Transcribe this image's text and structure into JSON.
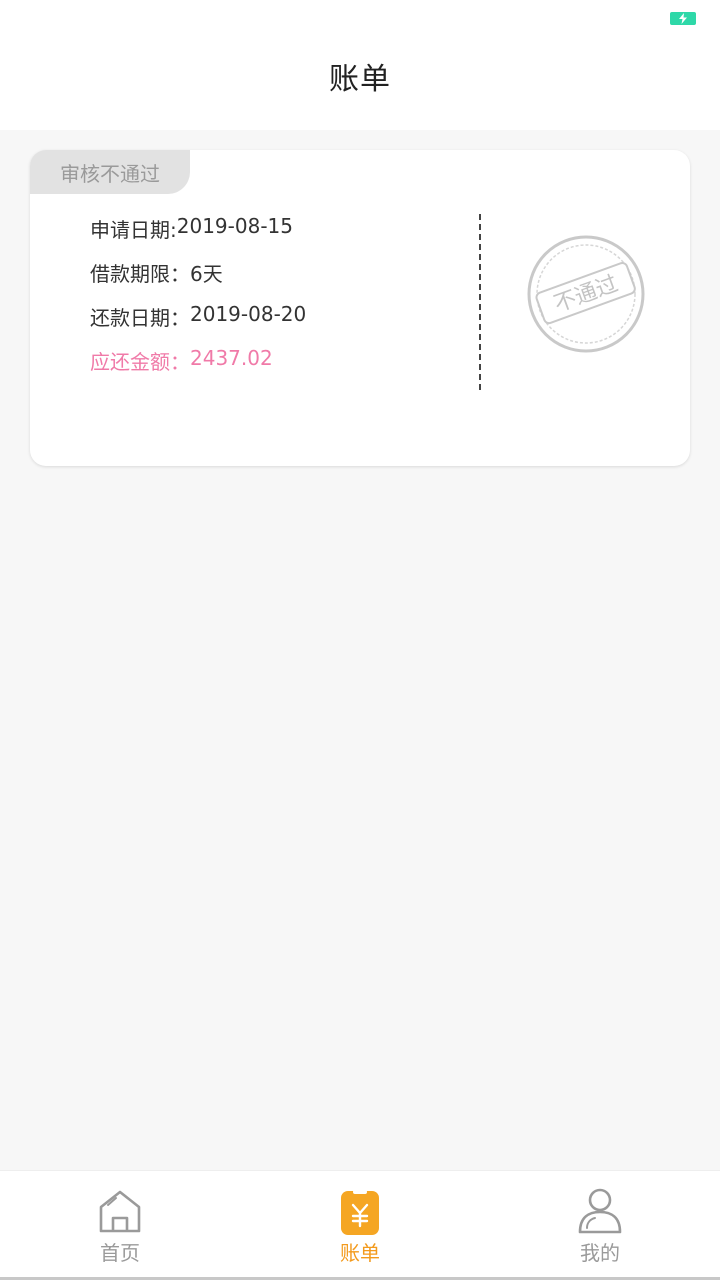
{
  "header": {
    "title": "账单"
  },
  "bill": {
    "status": "审核不通过",
    "apply_date_label": "申请日期:",
    "apply_date": "2019-08-15",
    "term_label": "借款期限：",
    "term": "6天",
    "repay_date_label": "还款日期：",
    "repay_date": "2019-08-20",
    "amount_label": "应还金额：",
    "amount": "2437.02",
    "stamp_text": "不通过"
  },
  "tabbar": {
    "items": [
      {
        "label": "首页",
        "icon": "home-icon"
      },
      {
        "label": "账单",
        "icon": "bill-icon"
      },
      {
        "label": "我的",
        "icon": "user-icon"
      }
    ],
    "active": "账单"
  },
  "colors": {
    "accent": "#f39a1c",
    "amount": "#f07aa8",
    "battery": "#2ed8a8",
    "tag_bg": "#e2e2e2"
  }
}
